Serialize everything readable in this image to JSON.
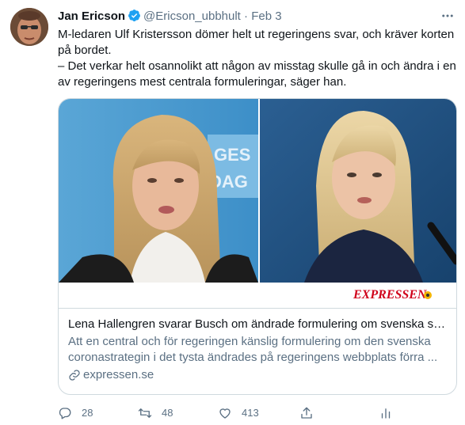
{
  "author": {
    "name": "Jan Ericson",
    "handle": "@Ericson_ubbhult",
    "separator": "·",
    "date": "Feb 3"
  },
  "tweet": {
    "text": "M-ledaren Ulf Kristersson dömer helt ut regeringens svar, och kräver korten på bordet.\n– Det verkar helt osannolikt att någon av misstag skulle gå in och ändra i en av regeringens mest centrala formuleringar, säger han."
  },
  "card": {
    "watermark": "EXPRESSEN",
    "backdrop_text_line1": "GES",
    "backdrop_text_line2": "DAG",
    "title": "Lena Hallengren svarar Busch om ändrade formulering om svenska str...",
    "description": "Att en central och för regeringen känslig formulering om den svenska coronastrategin i det tysta ändrades på regeringens webbplats förra ...",
    "domain": "expressen.se"
  },
  "actions": {
    "reply_count": "28",
    "retweet_count": "48",
    "like_count": "413"
  },
  "colors": {
    "verified": "#1da1f2",
    "secondary_text": "#5b7083",
    "border": "#cfd9de",
    "watermark": "#d0021b"
  }
}
